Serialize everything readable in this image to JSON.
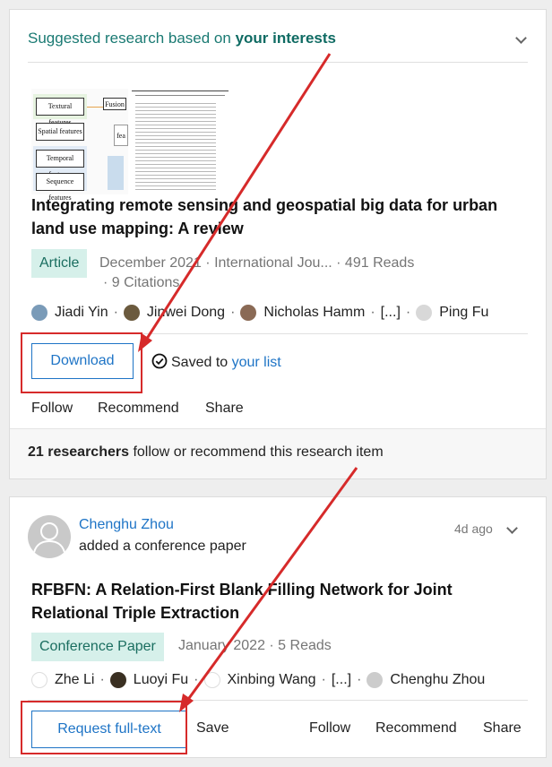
{
  "colors": {
    "accent": "#1e74c6",
    "teal": "#1a7a73",
    "badge_bg": "#d6f0ea",
    "annotation_red": "#d62a2a"
  },
  "card1": {
    "suggestion_prefix": "Suggested research based on",
    "suggestion_highlight": "your interests",
    "thumb_labels": [
      "Textural features",
      "Spatial features",
      "Temporal features",
      "Sequence features",
      "Fusion",
      "fea"
    ],
    "title_line1": "Integrating remote sensing and geospatial big data for urban",
    "title_line2": "land use mapping: A review",
    "type_badge": "Article",
    "meta_line1": "December 2021 · International Jou... · 491 Reads",
    "meta_line2": "· 9 Citations",
    "authors": [
      "Jiadi Yin",
      "Jinwei Dong",
      "Nicholas Hamm",
      "[...]",
      "Ping Fu"
    ],
    "download_label": "Download",
    "saved_prefix": "Saved to",
    "saved_link": "your list",
    "follow_label": "Follow",
    "recommend_label": "Recommend",
    "share_label": "Share",
    "footer_bold": "21 researchers",
    "footer_rest": "follow or recommend this research item"
  },
  "card2": {
    "user_name": "Chenghu Zhou",
    "user_action": "added a conference paper",
    "time_ago": "4d ago",
    "title_line1": "RFBFN: A Relation-First Blank Filling Network for Joint",
    "title_line2": "Relational Triple Extraction",
    "type_badge": "Conference Paper",
    "meta": "January 2022 · 5 Reads",
    "authors": [
      "Zhe Li",
      "Luoyi Fu",
      "Xinbing Wang",
      "[...]",
      "Chenghu Zhou"
    ],
    "request_label": "Request full-text",
    "save_label": "Save",
    "follow_label": "Follow",
    "recommend_label": "Recommend",
    "share_label": "Share"
  }
}
